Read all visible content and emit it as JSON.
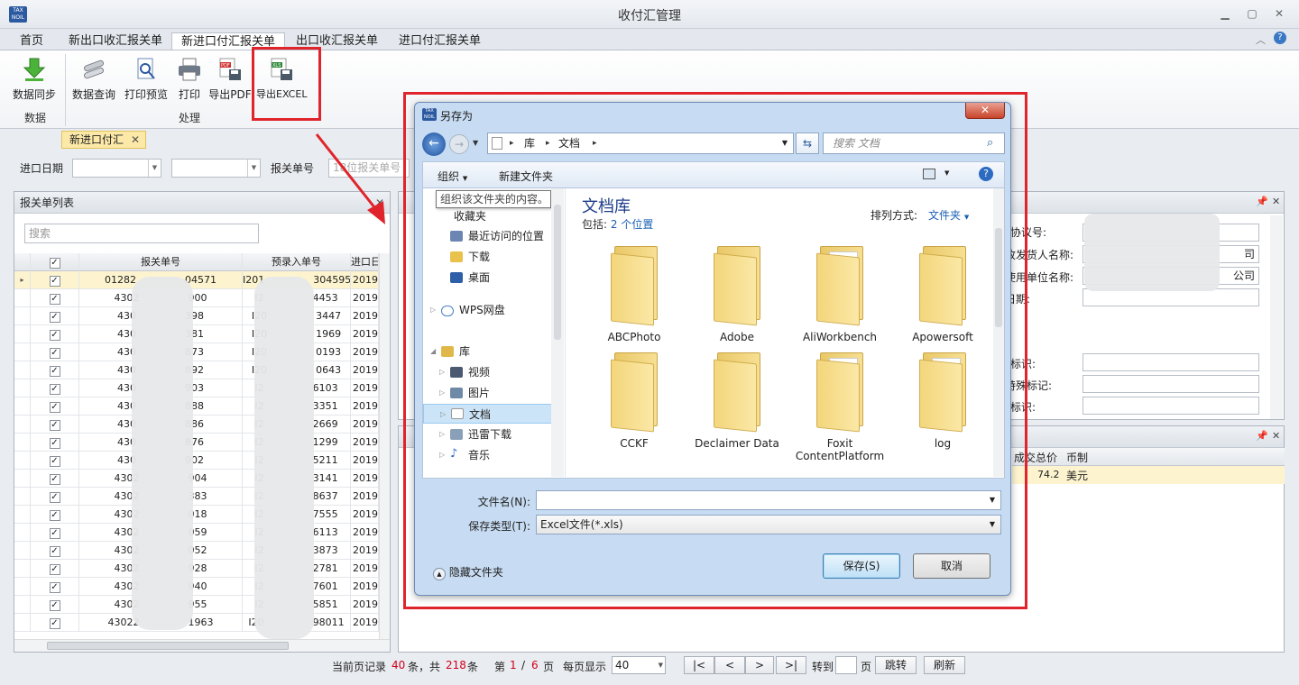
{
  "app": {
    "title": "收付汇管理",
    "logo_text": "TAX\nNOIL"
  },
  "ribbon_tabs": [
    "首页",
    "新出口收汇报关单",
    "新进口付汇报关单",
    "出口收汇报关单",
    "进口付汇报关单"
  ],
  "ribbon_buttons": {
    "sync": "数据同步",
    "query": "数据查询",
    "preview": "打印预览",
    "print": "打印",
    "pdf": "导出PDF",
    "excel": "导出EXCEL"
  },
  "ribbon_groups": {
    "data": "数据",
    "process": "处理"
  },
  "doc_tab": "新进口付汇",
  "filter": {
    "date_label": "进口日期",
    "decl_label": "报关单号",
    "decl_placeholder": "18位报关单号"
  },
  "left_panel": {
    "title": "报关单列表",
    "search_placeholder": "搜索",
    "columns": [
      "报关单号",
      "预录入单号",
      "进口日"
    ],
    "rows": [
      [
        "01282",
        "04571",
        "I201",
        "304595",
        "2019-0"
      ],
      [
        "4302",
        "900",
        "I2",
        "4453",
        "2019-0"
      ],
      [
        "430",
        "398",
        "I20",
        "3447",
        "2019-0"
      ],
      [
        "430",
        "381",
        "I20",
        "1969",
        "2019-0"
      ],
      [
        "430",
        "873",
        "I20",
        "0193",
        "2019-0"
      ],
      [
        "430",
        "892",
        "I20",
        "0643",
        "2019-0"
      ],
      [
        "430",
        "903",
        "I2",
        "6103",
        "2019-0"
      ],
      [
        "430",
        "888",
        "I2",
        "3351",
        "2019-0"
      ],
      [
        "430",
        "886",
        "I2",
        "2669",
        "2019-0"
      ],
      [
        "430",
        "876",
        "I2",
        "1299",
        "2019-0"
      ],
      [
        "430",
        "902",
        "I2",
        "5211",
        "2019-0"
      ],
      [
        "4302",
        "904",
        "I2",
        "3141",
        "2019-0"
      ],
      [
        "4302",
        "383",
        "I2",
        "8637",
        "2019-0"
      ],
      [
        "4302",
        "018",
        "I2",
        "7555",
        "2019-0"
      ],
      [
        "4302",
        "059",
        "I2",
        "6113",
        "2019-0"
      ],
      [
        "4302",
        "052",
        "I2",
        "3873",
        "2019-0"
      ],
      [
        "4302",
        "928",
        "I2",
        "2781",
        "2019-0"
      ],
      [
        "4302",
        "940",
        "I2",
        "7601",
        "2019-0"
      ],
      [
        "4302",
        "955",
        "I2",
        "5851",
        "2019-0"
      ],
      [
        "43022",
        "1963",
        "I20",
        "98011",
        "2019-0"
      ]
    ]
  },
  "right_top": {
    "labels": [
      "协议号:",
      "收发货人名称:",
      "使用单位名称:",
      "日期:",
      "标识:",
      "特殊标记:",
      "标识:"
    ],
    "values": [
      "",
      "司",
      "公司",
      "",
      "",
      "",
      ""
    ]
  },
  "right_bot": {
    "columns": [
      "成交总价",
      "币制"
    ],
    "row": [
      "74.2",
      "美元"
    ]
  },
  "pager": {
    "prefix": "当前页记录",
    "count": "40",
    "mid": "条，共",
    "total": "218",
    "suffix": "条",
    "page_label": "第",
    "page": "1",
    "sep": "/",
    "pages": "6",
    "page_unit": "页",
    "per_page_label": "每页显示",
    "per_page": "40",
    "first": "|<",
    "prev": "<",
    "next": ">",
    "last": ">|",
    "goto_label": "转到",
    "goto_unit": "页",
    "goto_btn": "跳转",
    "refresh_btn": "刷新"
  },
  "dialog": {
    "title": "另存为",
    "path": [
      "库",
      "文档"
    ],
    "search_placeholder": "搜索 文档",
    "organize": "组织",
    "new_folder": "新建文件夹",
    "tooltip": "组织该文件夹的内容。",
    "nav": {
      "favorites": "收藏夹",
      "recent": "最近访问的位置",
      "downloads": "下载",
      "desktop": "桌面",
      "wps": "WPS网盘",
      "library": "库",
      "videos": "视频",
      "pictures": "图片",
      "documents": "文档",
      "thunder": "迅雷下载",
      "music": "音乐"
    },
    "lib_title": "文档库",
    "lib_includes": "包括:",
    "lib_locations": "2 个位置",
    "sort_label": "排列方式:",
    "sort_value": "文件夹",
    "folders": [
      "ABCPhoto",
      "Adobe",
      "AliWorkbench",
      "Apowersoft",
      "CCKF",
      "Declaimer Data",
      "Foxit ContentPlatform",
      "log"
    ],
    "filename_label": "文件名(N):",
    "filename_value": "",
    "filetype_label": "保存类型(T):",
    "filetype_value": "Excel文件(*.xls)",
    "hide_folders": "隐藏文件夹",
    "save": "保存(S)",
    "cancel": "取消"
  },
  "colors": {
    "highlight": "#e0242b",
    "accent": "#2c5aa0",
    "red_text": "#d0021b"
  }
}
